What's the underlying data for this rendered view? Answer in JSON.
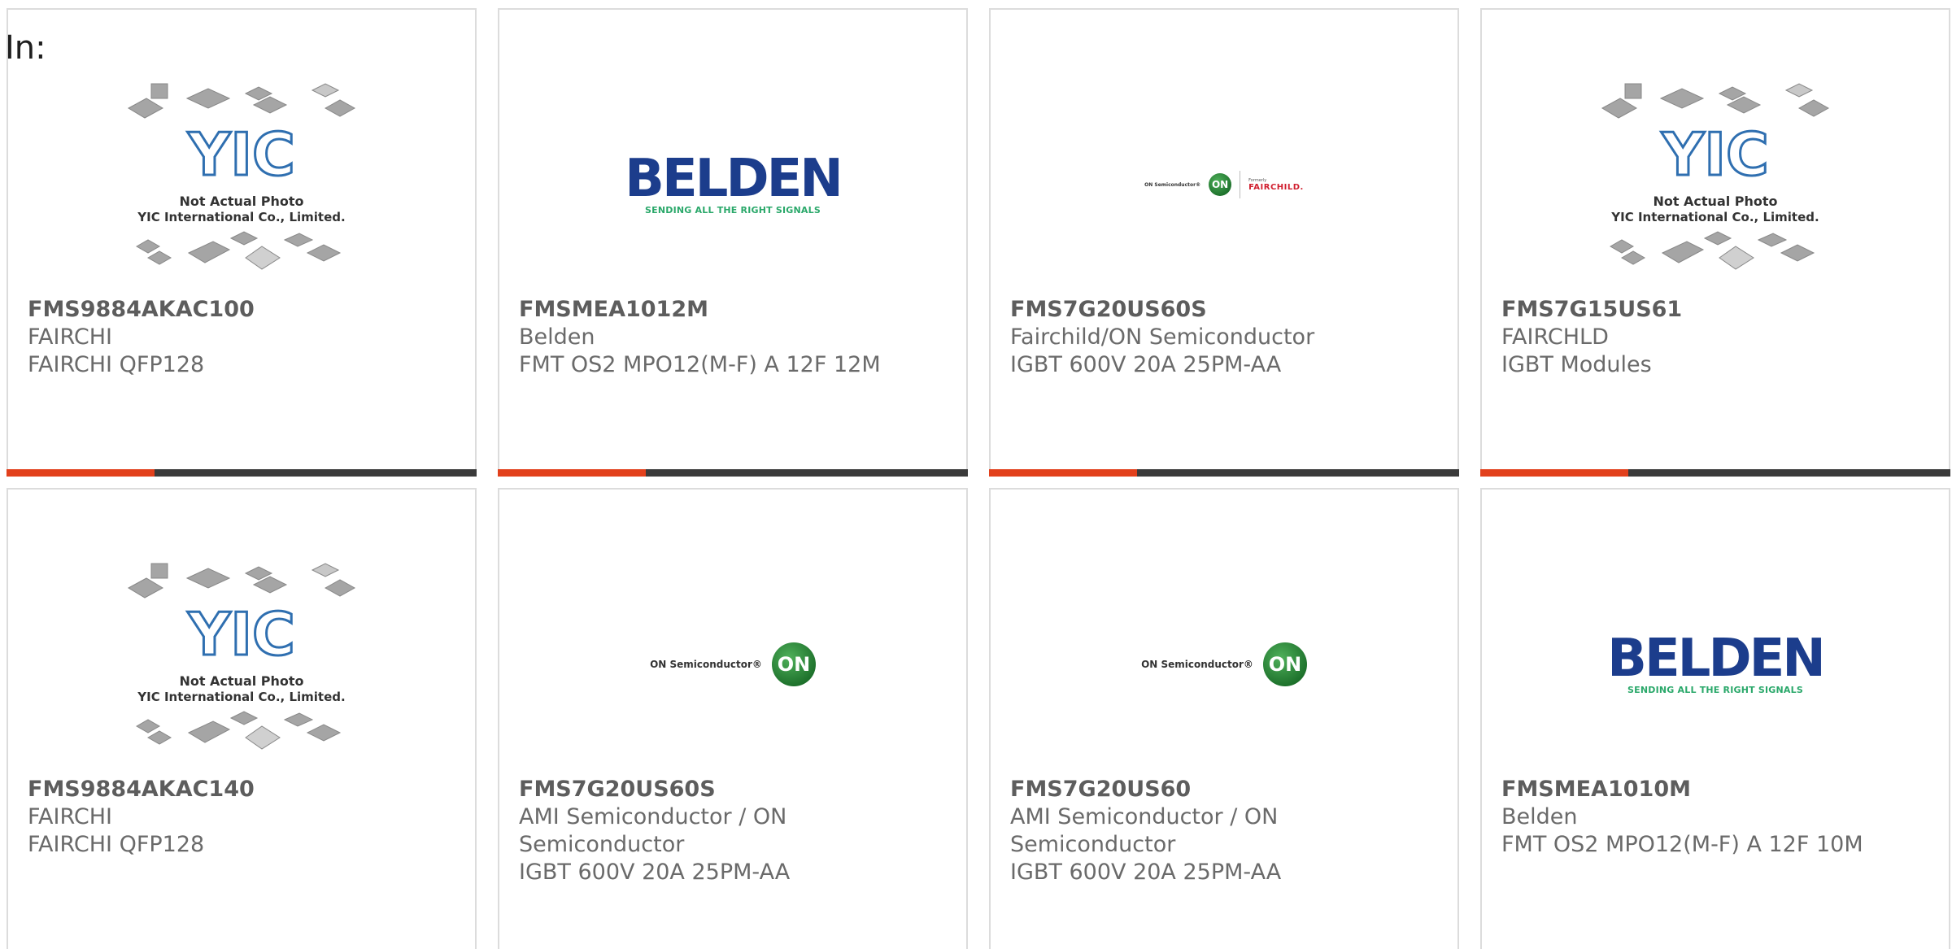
{
  "filter": {
    "in_label": "In:"
  },
  "products": [
    {
      "part_number": "FMS9884AKAC100",
      "manufacturer": "FAIRCHI",
      "description": "FAIRCHI QFP128",
      "image": {
        "type": "yic-placeholder",
        "caption_line1": "Not Actual Photo",
        "caption_line2": "YIC International Co., Limited.",
        "logo_text": "YIC"
      }
    },
    {
      "part_number": "FMSMEA1012M",
      "manufacturer": "Belden",
      "description": "FMT OS2 MPO12(M-F) A 12F 12M",
      "image": {
        "type": "belden-logo",
        "word": "BELDEN",
        "tagline": "SENDING ALL THE RIGHT SIGNALS"
      }
    },
    {
      "part_number": "FMS7G20US60S",
      "manufacturer": "Fairchild/ON Semiconductor",
      "description": "IGBT 600V 20A 25PM-AA",
      "image": {
        "type": "on-fairchild-logo",
        "on_text": "ON Semiconductor®",
        "on_badge": "ON",
        "formerly": "Formerly",
        "fairchild": "FAIRCHILD."
      }
    },
    {
      "part_number": "FMS7G15US61",
      "manufacturer": "FAIRCHLD",
      "description": "IGBT Modules",
      "image": {
        "type": "yic-placeholder",
        "caption_line1": "Not Actual Photo",
        "caption_line2": "YIC International Co., Limited.",
        "logo_text": "YIC"
      }
    },
    {
      "part_number": "FMS9884AKAC140",
      "manufacturer": "FAIRCHI",
      "description": "FAIRCHI QFP128",
      "image": {
        "type": "yic-placeholder",
        "caption_line1": "Not Actual Photo",
        "caption_line2": "YIC International Co., Limited.",
        "logo_text": "YIC"
      }
    },
    {
      "part_number": "FMS7G20US60S",
      "manufacturer": "AMI Semiconductor / ON Semiconductor",
      "description": "IGBT 600V 20A 25PM-AA",
      "image": {
        "type": "on-logo",
        "on_text": "ON Semiconductor®",
        "on_badge": "ON"
      }
    },
    {
      "part_number": "FMS7G20US60",
      "manufacturer": "AMI Semiconductor / ON Semiconductor",
      "description": "IGBT 600V 20A 25PM-AA",
      "image": {
        "type": "on-logo",
        "on_text": "ON Semiconductor®",
        "on_badge": "ON"
      }
    },
    {
      "part_number": "FMSMEA1010M",
      "manufacturer": "Belden",
      "description": "FMT OS2 MPO12(M-F) A 12F 10M",
      "image": {
        "type": "belden-logo",
        "word": "BELDEN",
        "tagline": "SENDING ALL THE RIGHT SIGNALS"
      }
    }
  ],
  "colors": {
    "accent_bar": "#e2401c",
    "base_bar": "#3a3a3a",
    "card_border": "#dcdcdc",
    "text": "#6a6a6a",
    "yic_blue": "#2f6fb0",
    "belden_blue": "#1c3d8c",
    "belden_green": "#2aa86a",
    "on_green": "#1c6f2a",
    "fairchild_red": "#d01f2f"
  }
}
